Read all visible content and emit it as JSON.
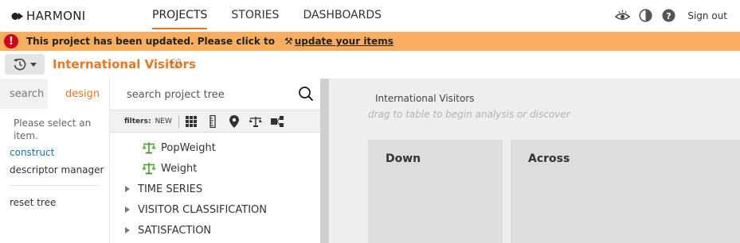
{
  "app": {
    "brand": "HARMONI"
  },
  "nav": {
    "items": [
      {
        "label": "PROJECTS",
        "active": true
      },
      {
        "label": "STORIES",
        "active": false
      },
      {
        "label": "DASHBOARDS",
        "active": false
      }
    ],
    "signout": "Sign out",
    "icons": [
      "eye-icon",
      "contrast-icon",
      "help-icon"
    ]
  },
  "banner": {
    "icon": "!",
    "message": "This project has been updated. Please click to",
    "wrench": "⚒",
    "link": "update your items",
    "color": "#f9ad5f"
  },
  "project": {
    "title": "International Visitors",
    "accent": "#e87722"
  },
  "left_panel": {
    "tabs": [
      "search",
      "design"
    ],
    "active_tab": "design",
    "message": "Please select an item.",
    "construct_link": "construct",
    "descriptor_manager": "descriptor manager",
    "reset_tree": "reset tree"
  },
  "tree_panel": {
    "search_placeholder": "search project tree",
    "filters_label": "filters:",
    "filters_new": "NEW",
    "filter_icons": [
      "table-icon",
      "ruler-icon",
      "location-icon",
      "balance-icon",
      "flow-icon"
    ],
    "items": [
      {
        "label": "PopWeight",
        "kind": "leaf",
        "icon": "scale-icon"
      },
      {
        "label": "Weight",
        "kind": "leaf",
        "icon": "scale-icon"
      },
      {
        "label": "TIME SERIES",
        "kind": "folder"
      },
      {
        "label": "VISITOR CLASSIFICATION",
        "kind": "folder"
      },
      {
        "label": "SATISFACTION",
        "kind": "folder"
      }
    ]
  },
  "workspace": {
    "title": "International Visitors",
    "hint": "drag to table to begin analysis or discover",
    "down_label": "Down",
    "across_label": "Across"
  }
}
